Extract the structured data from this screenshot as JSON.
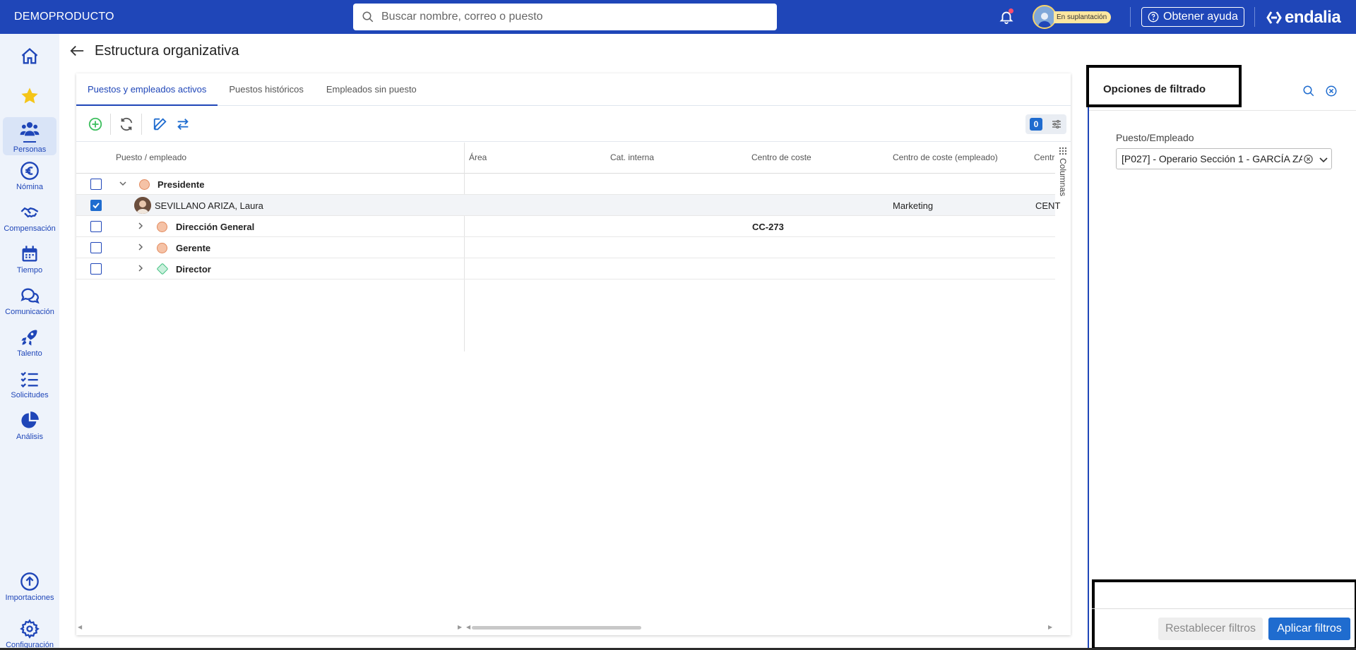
{
  "header": {
    "brand": "DEMOPRODUCTO",
    "search_placeholder": "Buscar nombre, correo o puesto",
    "impersonation_badge": "En suplantación",
    "help_label": "Obtener ayuda",
    "logo_text": "endalia"
  },
  "sidebar": {
    "items": [
      {
        "label": "",
        "icon": "home-icon"
      },
      {
        "label": "",
        "icon": "star-icon"
      },
      {
        "label": "Personas",
        "icon": "people-icon"
      },
      {
        "label": "Nómina",
        "icon": "euro-icon"
      },
      {
        "label": "Compensación",
        "icon": "handshake-icon"
      },
      {
        "label": "Tiempo",
        "icon": "calendar-icon"
      },
      {
        "label": "Comunicación",
        "icon": "chat-icon"
      },
      {
        "label": "Talento",
        "icon": "rocket-icon"
      },
      {
        "label": "Solicitudes",
        "icon": "checklist-icon"
      },
      {
        "label": "Análisis",
        "icon": "pie-chart-icon"
      },
      {
        "label": "Importaciones",
        "icon": "upload-icon"
      },
      {
        "label": "Configuración",
        "icon": "gear-icon"
      }
    ]
  },
  "page": {
    "title": "Estructura organizativa"
  },
  "tabs": [
    {
      "label": "Puestos y empleados activos",
      "active": true
    },
    {
      "label": "Puestos históricos",
      "active": false
    },
    {
      "label": "Empleados sin puesto",
      "active": false
    }
  ],
  "toolbar": {
    "filter_count": "0"
  },
  "grid": {
    "columns": [
      "Puesto / empleado",
      "Área",
      "Cat. interna",
      "Centro de coste",
      "Centro de coste (empleado)",
      "Centr"
    ],
    "columns_panel_label": "Columnas",
    "rows": [
      {
        "label": "Presidente",
        "type": "position",
        "checked": false,
        "expanded": true,
        "centro_coste": "",
        "centro_coste_empleado": "",
        "centro": ""
      },
      {
        "label": "SEVILLANO ARIZA, Laura",
        "type": "employee",
        "checked": true,
        "centro_coste": "",
        "centro_coste_empleado": "Marketing",
        "centro": "CENT"
      },
      {
        "label": "Dirección General",
        "type": "position",
        "checked": false,
        "expanded": false,
        "centro_coste": "CC-273",
        "centro_coste_empleado": "",
        "centro": ""
      },
      {
        "label": "Gerente",
        "type": "position",
        "checked": false,
        "expanded": false,
        "centro_coste": "",
        "centro_coste_empleado": "",
        "centro": ""
      },
      {
        "label": "Director",
        "type": "position-diamond",
        "checked": false,
        "expanded": false,
        "centro_coste": "",
        "centro_coste_empleado": "",
        "centro": ""
      }
    ]
  },
  "filter_panel": {
    "title": "Opciones de filtrado",
    "field_label": "Puesto/Empleado",
    "field_value": "[P027] - Operario Sección 1 - GARCÍA ZA",
    "reset_label": "Restablecer filtros",
    "apply_label": "Aplicar filtros"
  },
  "colors": {
    "primary": "#1f46b8",
    "accent": "#1f6ccf",
    "sidebar_bg": "#eef3fb"
  }
}
